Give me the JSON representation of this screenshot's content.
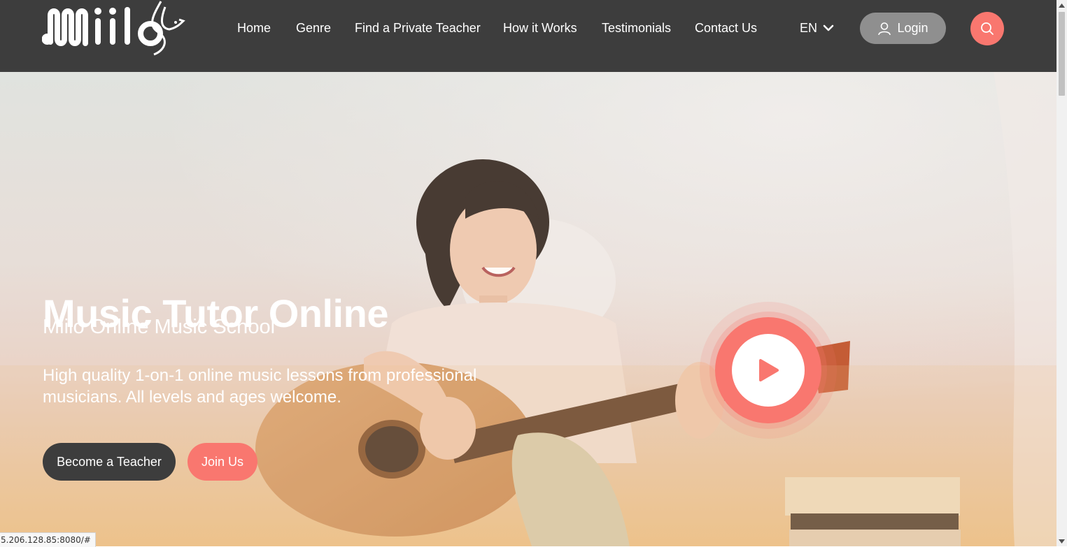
{
  "brand": {
    "logo_text": "Miilo"
  },
  "nav": {
    "items": [
      {
        "label": "Home"
      },
      {
        "label": "Genre"
      },
      {
        "label": "Find a Private Teacher"
      },
      {
        "label": "How it Works"
      },
      {
        "label": "Testimonials"
      },
      {
        "label": "Contact Us"
      }
    ],
    "language": "EN",
    "login_label": "Login"
  },
  "hero": {
    "title": "Music Tutor Online",
    "subtitle": "Miilo Online Music School",
    "description": "High quality 1-on-1 online music lessons from professional musicians. All levels and ages welcome.",
    "primary_button": "Become a Teacher",
    "secondary_button": "Join Us"
  },
  "status_bar": {
    "url": "5.206.128.85:8080/#"
  },
  "colors": {
    "header_bg": "#3d3d3d",
    "accent": "#f9776f",
    "login_bg": "#8f8f8f",
    "dark_button": "#3d3d3d"
  },
  "icons": {
    "login": "user-icon",
    "search": "search-icon",
    "language": "chevron-down-icon",
    "video": "play-icon"
  }
}
